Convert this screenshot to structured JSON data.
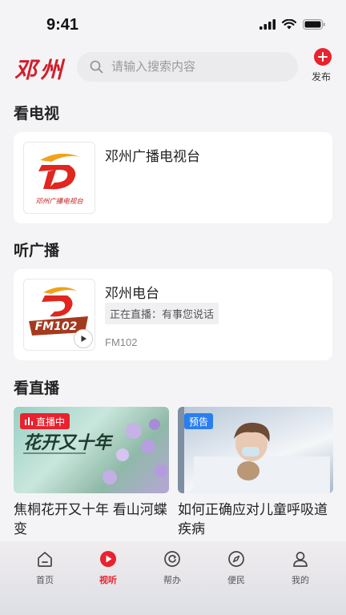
{
  "status_bar": {
    "time": "9:41"
  },
  "header": {
    "logo_text": "邓州",
    "search_placeholder": "请输入搜索内容",
    "publish_label": "发布"
  },
  "tv_section": {
    "title": "看电视",
    "station_name": "邓州广播电视台",
    "logo_caption": "邓州广播电视台"
  },
  "radio_section": {
    "title": "听广播",
    "station_name": "邓州电台",
    "live_status": "正在直播：有事您说话",
    "frequency": "FM102",
    "logo_badge": "FM102"
  },
  "live_section": {
    "title": "看直播",
    "videos": [
      {
        "badge": "直播中",
        "title": "焦桐花开又十年 看山河蝶变",
        "poster_text": "花开又十年"
      },
      {
        "badge": "预告",
        "title": "如何正确应对儿童呼吸道疾病"
      }
    ]
  },
  "tabbar": {
    "items": [
      {
        "label": "首页",
        "icon": "home-icon"
      },
      {
        "label": "视听",
        "icon": "play-icon",
        "active": true
      },
      {
        "label": "帮办",
        "icon": "help-icon"
      },
      {
        "label": "便民",
        "icon": "compass-icon"
      },
      {
        "label": "我的",
        "icon": "user-icon"
      }
    ]
  },
  "colors": {
    "brand_red": "#e8222e",
    "preview_blue": "#2a7ff0"
  }
}
